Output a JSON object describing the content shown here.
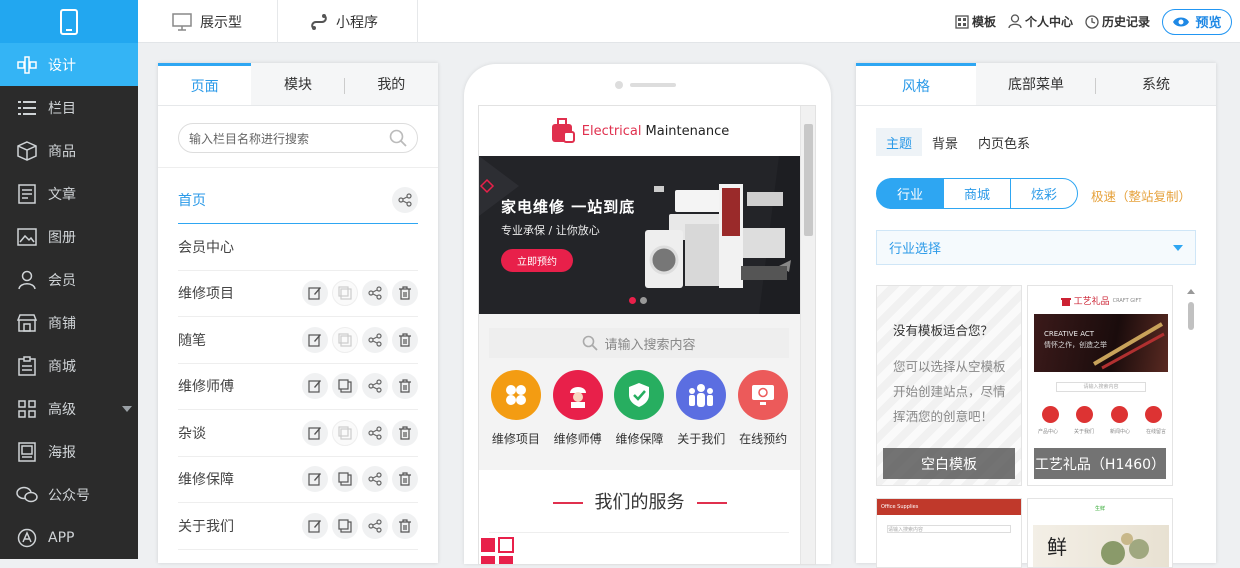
{
  "nav": {
    "items": [
      {
        "label": "设计",
        "icon": "design-icon",
        "active": true
      },
      {
        "label": "栏目",
        "icon": "list-icon"
      },
      {
        "label": "商品",
        "icon": "box-icon"
      },
      {
        "label": "文章",
        "icon": "article-icon"
      },
      {
        "label": "图册",
        "icon": "image-icon"
      },
      {
        "label": "会员",
        "icon": "user-icon"
      },
      {
        "label": "商铺",
        "icon": "shop-icon"
      },
      {
        "label": "商城",
        "icon": "mall-icon"
      },
      {
        "label": "高级",
        "icon": "grid-icon",
        "has_caret": true
      },
      {
        "label": "海报",
        "icon": "poster-icon"
      },
      {
        "label": "公众号",
        "icon": "wechat-icon"
      },
      {
        "label": "APP",
        "icon": "app-icon"
      }
    ]
  },
  "topbar": {
    "tabs": [
      "展示型",
      "小程序"
    ],
    "links": [
      "模板",
      "个人中心",
      "历史记录"
    ],
    "preview_label": "预览"
  },
  "left_panel": {
    "tabs": [
      "页面",
      "模块",
      "我的"
    ],
    "search_placeholder": "输入栏目名称进行搜索",
    "menu": [
      "首页",
      "会员中心",
      "维修项目",
      "随笔",
      "维修师傅",
      "杂谈",
      "维修保障",
      "关于我们"
    ]
  },
  "phone": {
    "brand_red": "Electrical",
    "brand_dark": "Maintenance",
    "banner": {
      "headline": "家电维修  一站到底",
      "subline": "专业承保 / 让你放心",
      "button": "立即预约"
    },
    "search_placeholder": "请输入搜索内容",
    "icons": [
      {
        "label": "维修项目",
        "color": "#f39c12"
      },
      {
        "label": "维修师傅",
        "color": "#e8204a"
      },
      {
        "label": "维修保障",
        "color": "#27ae60"
      },
      {
        "label": "关于我们",
        "color": "#5b6ee1"
      },
      {
        "label": "在线预约",
        "color": "#ec5a5a"
      }
    ],
    "section_title": "我们的服务"
  },
  "right_panel": {
    "tabs": [
      "风格",
      "底部菜单",
      "系统"
    ],
    "subtabs": [
      "主题",
      "背景",
      "内页色系"
    ],
    "segments": [
      "行业",
      "商城",
      "炫彩"
    ],
    "fast_link": "极速（整站复制）",
    "industry_select": "行业选择",
    "blank_card": {
      "question": "没有模板适合您？",
      "desc": "您可以选择从空模板开始创建站点，尽情挥洒您的创意吧！",
      "caption": "空白模板"
    },
    "craft_card": {
      "logo": "工艺礼品",
      "logo_sub": "CRAFT GIFT",
      "img_line1": "CREATIVE ACT",
      "img_line2": "情怀之作，创造之举",
      "search": "请输入搜索内容",
      "nav": [
        "产品中心",
        "关于我们",
        "新闻中心",
        "在线留言"
      ],
      "caption": "工艺礼品（H1460）"
    },
    "card3": {
      "bar_text": "Office Supplies",
      "search": "请输入搜索内容"
    },
    "card4": {
      "logo": "生鲜",
      "big_char": "鲜"
    }
  },
  "colors": {
    "accent": "#2ea6f2",
    "nav_bg": "#2b2b2b",
    "brand": "#e0304e",
    "fast_link": "#e6a23c"
  }
}
